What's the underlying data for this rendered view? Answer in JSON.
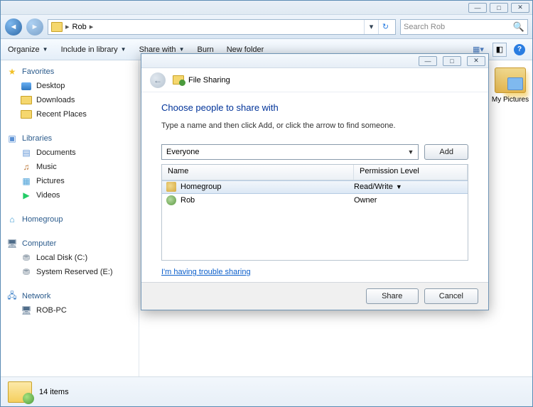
{
  "breadcrumb": {
    "folder": "Rob"
  },
  "search": {
    "placeholder": "Search Rob"
  },
  "toolbar": {
    "organize": "Organize",
    "include": "Include in library",
    "share": "Share with",
    "burn": "Burn",
    "newfolder": "New folder"
  },
  "sidebar": {
    "favorites": {
      "label": "Favorites",
      "items": [
        "Desktop",
        "Downloads",
        "Recent Places"
      ]
    },
    "libraries": {
      "label": "Libraries",
      "items": [
        "Documents",
        "Music",
        "Pictures",
        "Videos"
      ]
    },
    "homegroup": {
      "label": "Homegroup"
    },
    "computer": {
      "label": "Computer",
      "items": [
        "Local Disk (C:)",
        "System Reserved (E:)"
      ]
    },
    "network": {
      "label": "Network",
      "items": [
        "ROB-PC"
      ]
    }
  },
  "content": {
    "my_pictures_label": "My Pictures"
  },
  "statusbar": {
    "count": "14 items"
  },
  "dialog": {
    "title": "File Sharing",
    "heading": "Choose people to share with",
    "instruction": "Type a name and then click Add, or click the arrow to find someone.",
    "combo_value": "Everyone",
    "add_btn": "Add",
    "col_name": "Name",
    "col_perm": "Permission Level",
    "rows": [
      {
        "name": "Homegroup",
        "perm": "Read/Write"
      },
      {
        "name": "Rob",
        "perm": "Owner"
      }
    ],
    "trouble": "I'm having trouble sharing",
    "share_btn": "Share",
    "cancel_btn": "Cancel"
  }
}
